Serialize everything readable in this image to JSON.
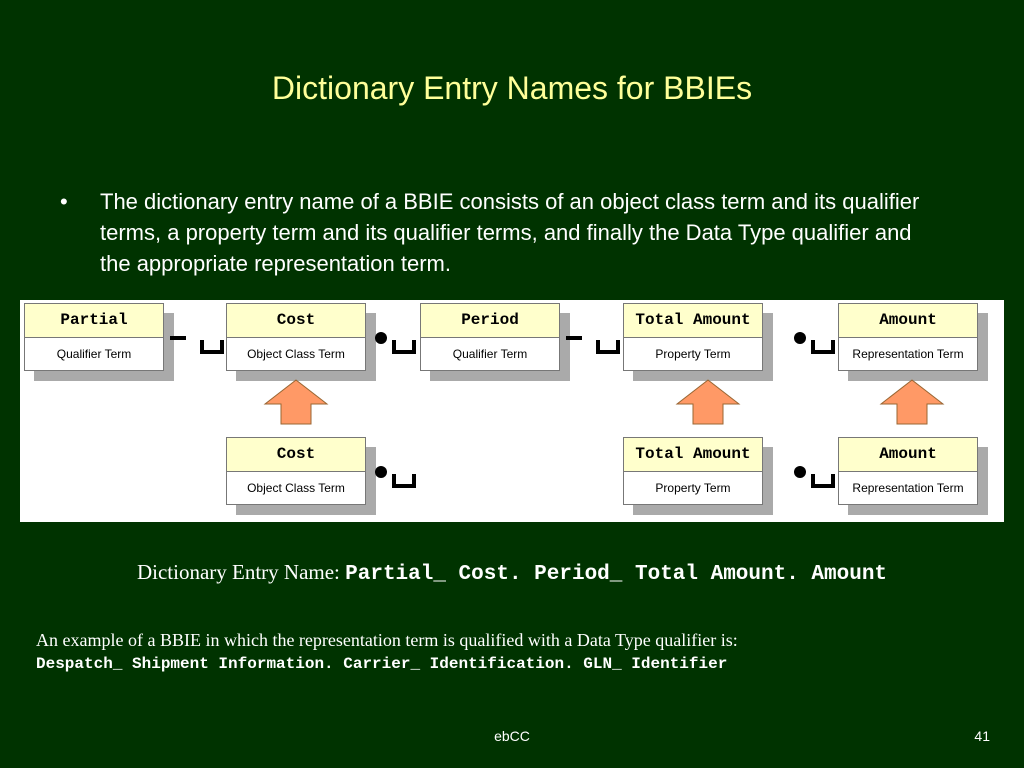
{
  "title": "Dictionary Entry Names for BBIEs",
  "bullet": {
    "symbol": "•",
    "text": "The dictionary entry name of a BBIE consists of an object class term and its qualifier terms, a property term and its qualifier terms, and finally the Data Type qualifier and the appropriate representation term."
  },
  "diagram": {
    "top_row": [
      {
        "term": "Partial",
        "kind": "Qualifier Term"
      },
      {
        "term": "Cost",
        "kind": "Object Class Term"
      },
      {
        "term": "Period",
        "kind": "Qualifier Term"
      },
      {
        "term": "Total Amount",
        "kind": "Property Term"
      },
      {
        "term": "Amount",
        "kind": "Representation  Term"
      }
    ],
    "bottom_row": [
      {
        "term": "Cost",
        "kind": "Object Class Term"
      },
      {
        "term": "Total Amount",
        "kind": "Property Term"
      },
      {
        "term": "Amount",
        "kind": "Representation  Term"
      }
    ],
    "arrow_color": "#ff9966"
  },
  "den": {
    "label": "Dictionary Entry Name: ",
    "value": "Partial_ Cost. Period_ Total Amount. Amount"
  },
  "example": {
    "text": "An example of a BBIE in which the representation term is qualified with a Data Type qualifier is:",
    "value": "Despatch_ Shipment Information. Carrier_ Identification. GLN_ Identifier"
  },
  "footer": {
    "center": "ebCC",
    "page": "41"
  }
}
